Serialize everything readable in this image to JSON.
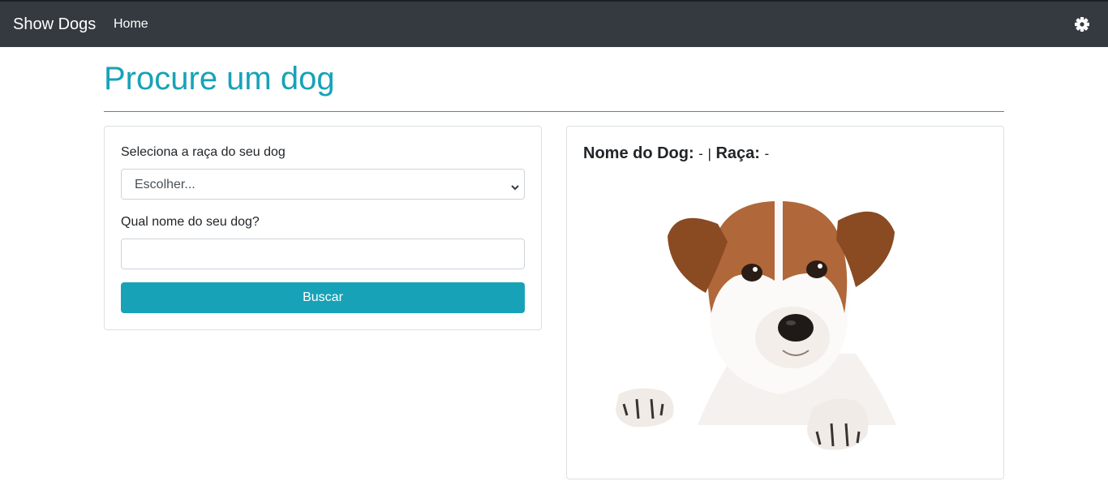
{
  "navbar": {
    "brand": "Show Dogs",
    "home_label": "Home",
    "settings_icon": "gear-icon"
  },
  "page": {
    "title": "Procure um dog",
    "accent_color": "#17a2b8"
  },
  "form": {
    "breed_label": "Seleciona a raça do seu dog",
    "breed_select_value": "Escolher...",
    "name_label": "Qual nome do seu dog?",
    "name_value": "",
    "submit_label": "Buscar"
  },
  "result": {
    "name_label": "Nome do Dog:",
    "name_value": "-",
    "separator": "|",
    "breed_label": "Raça:",
    "breed_value": "-",
    "image": "jack-russell-terrier-photo"
  }
}
